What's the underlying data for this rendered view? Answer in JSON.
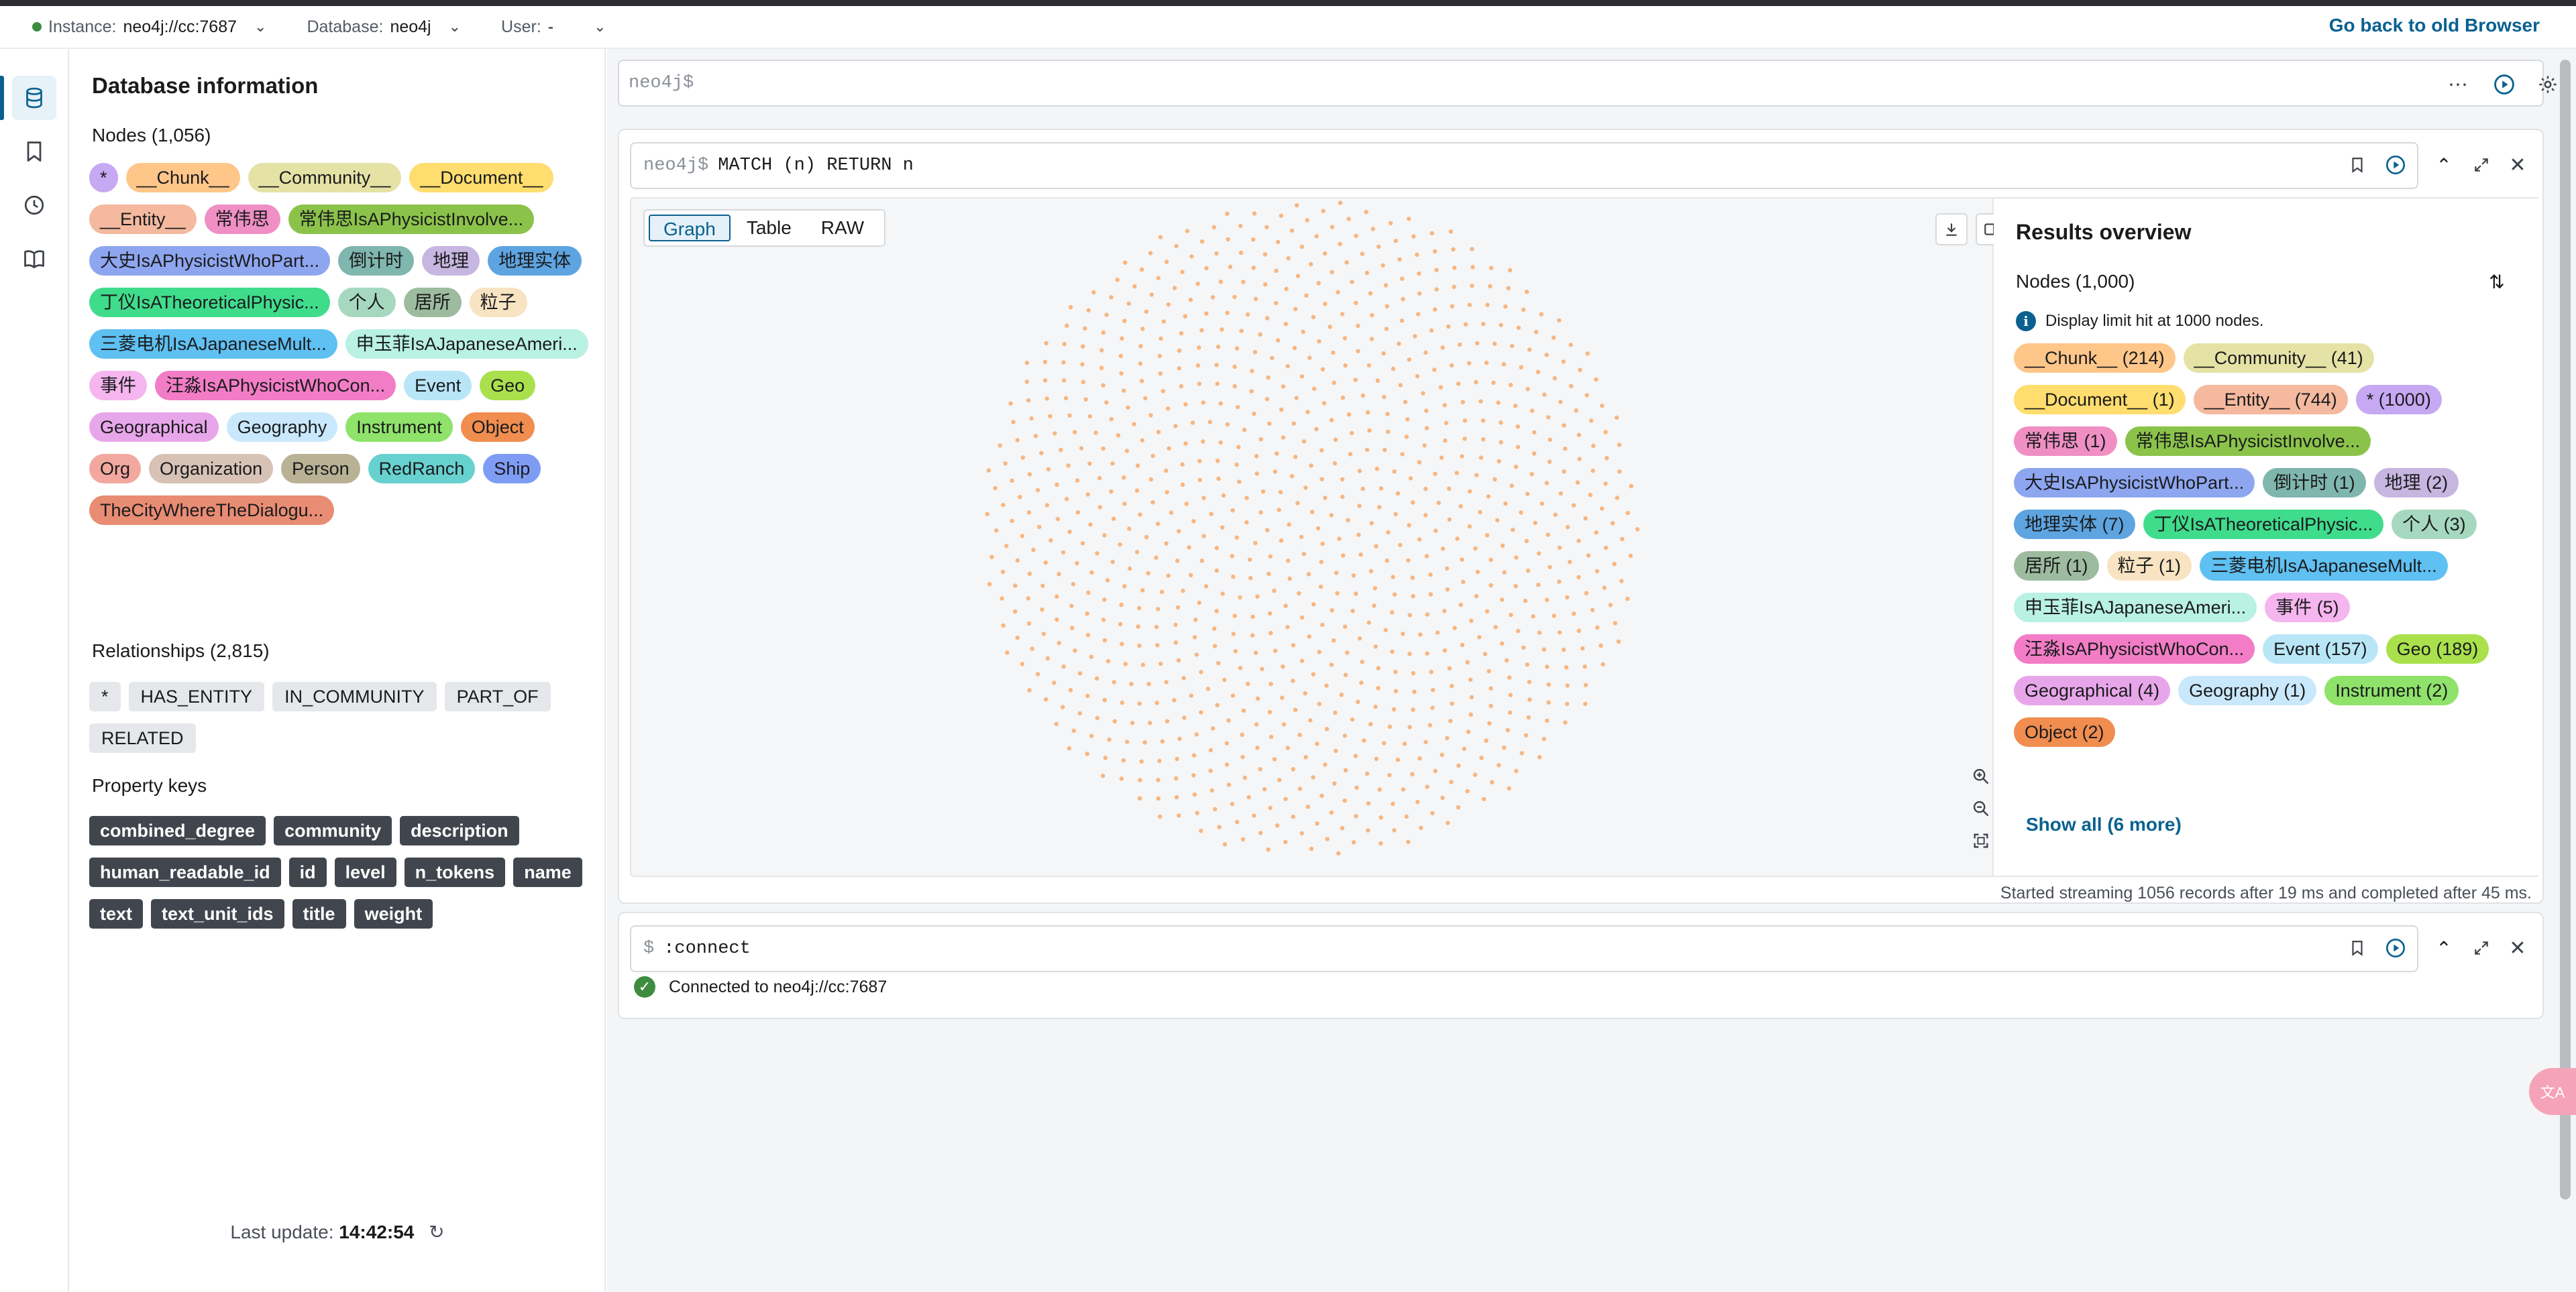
{
  "topbar": {
    "instance_label": "Instance:",
    "instance_value": "neo4j://cc:7687",
    "database_label": "Database:",
    "database_value": "neo4j",
    "user_label": "User:",
    "user_value": "-",
    "go_back": "Go back to old Browser"
  },
  "db_panel": {
    "title": "Database information",
    "nodes_heading": "Nodes (1,056)",
    "node_labels": [
      {
        "label": "*",
        "color": "#c7a8f2"
      },
      {
        "label": "__Chunk__",
        "color": "#ffc68a"
      },
      {
        "label": "__Community__",
        "color": "#e5e2a6"
      },
      {
        "label": "__Document__",
        "color": "#ffdd6e"
      },
      {
        "label": "__Entity__",
        "color": "#f4b99f"
      },
      {
        "label": "常伟思",
        "color": "#ef8fc4"
      },
      {
        "label": "常伟思IsAPhysicistInvolve...",
        "color": "#8bc34a"
      },
      {
        "label": "大史IsAPhysicistWhoPart...",
        "color": "#8ea6ef"
      },
      {
        "label": "倒计时",
        "color": "#7fb6ae"
      },
      {
        "label": "地理",
        "color": "#c7b6e0"
      },
      {
        "label": "地理实体",
        "color": "#5ea4e0"
      },
      {
        "label": "丁仪IsATheoreticalPhysic...",
        "color": "#3fdc8c"
      },
      {
        "label": "个人",
        "color": "#a6d8c0"
      },
      {
        "label": "居所",
        "color": "#9dbb9f"
      },
      {
        "label": "粒子",
        "color": "#f8e3c2"
      },
      {
        "label": "三菱电机IsAJapaneseMult...",
        "color": "#5fc0f2"
      },
      {
        "label": "申玉菲IsAJapaneseAmeri...",
        "color": "#b9f1e2"
      },
      {
        "label": "事件",
        "color": "#f5b5ee"
      },
      {
        "label": "汪淼IsAPhysicistWhoCon...",
        "color": "#f27cc6"
      },
      {
        "label": "Event",
        "color": "#b8e6f7"
      },
      {
        "label": "Geo",
        "color": "#a9e04c"
      },
      {
        "label": "Geographical",
        "color": "#e8a6ea"
      },
      {
        "label": "Geography",
        "color": "#c9e8fb"
      },
      {
        "label": "Instrument",
        "color": "#8fe26a"
      },
      {
        "label": "Object",
        "color": "#f08d4f"
      },
      {
        "label": "Org",
        "color": "#f2a89e"
      },
      {
        "label": "Organization",
        "color": "#d7c2b5"
      },
      {
        "label": "Person",
        "color": "#b8b193"
      },
      {
        "label": "RedRanch",
        "color": "#67d1cf"
      },
      {
        "label": "Ship",
        "color": "#7f9cf5"
      },
      {
        "label": "TheCityWhereTheDialogu...",
        "color": "#e88c73"
      }
    ],
    "relationships_heading": "Relationships (2,815)",
    "relationship_types": [
      "*",
      "HAS_ENTITY",
      "IN_COMMUNITY",
      "PART_OF",
      "RELATED"
    ],
    "property_keys_heading": "Property keys",
    "property_keys": [
      "combined_degree",
      "community",
      "description",
      "human_readable_id",
      "id",
      "level",
      "n_tokens",
      "name",
      "text",
      "text_unit_ids",
      "title",
      "weight"
    ],
    "last_update_label": "Last update:",
    "last_update_time": "14:42:54"
  },
  "editor": {
    "placeholder": "neo4j$"
  },
  "frame1": {
    "prompt": "neo4j$",
    "query": "MATCH (n) RETURN n",
    "tabs": [
      "Graph",
      "Table",
      "RAW"
    ],
    "active_tab": "Graph",
    "graph_node_color": "#f7b681",
    "results_title": "Results overview",
    "results_nodes": "Nodes (1,000)",
    "results_info": "Display limit hit at 1000 nodes.",
    "result_labels": [
      {
        "label": "__Chunk__ (214)",
        "color": "#ffc68a"
      },
      {
        "label": "__Community__ (41)",
        "color": "#e5e2a6"
      },
      {
        "label": "__Document__ (1)",
        "color": "#ffdd6e"
      },
      {
        "label": "__Entity__ (744)",
        "color": "#f4b99f"
      },
      {
        "label": "* (1000)",
        "color": "#c7a8f2"
      },
      {
        "label": "常伟思 (1)",
        "color": "#ef8fc4"
      },
      {
        "label": "常伟思IsAPhysicistInvolve...",
        "color": "#8bc34a"
      },
      {
        "label": "大史IsAPhysicistWhoPart...",
        "color": "#8ea6ef"
      },
      {
        "label": "倒计时 (1)",
        "color": "#7fb6ae"
      },
      {
        "label": "地理 (2)",
        "color": "#c7b6e0"
      },
      {
        "label": "地理实体 (7)",
        "color": "#5ea4e0"
      },
      {
        "label": "丁仪IsATheoreticalPhysic...",
        "color": "#3fdc8c"
      },
      {
        "label": "个人 (3)",
        "color": "#a6d8c0"
      },
      {
        "label": "居所 (1)",
        "color": "#9dbb9f"
      },
      {
        "label": "粒子 (1)",
        "color": "#f8e3c2"
      },
      {
        "label": "三菱电机IsAJapaneseMult...",
        "color": "#5fc0f2"
      },
      {
        "label": "申玉菲IsAJapaneseAmeri...",
        "color": "#b9f1e2"
      },
      {
        "label": "事件 (5)",
        "color": "#f5b5ee"
      },
      {
        "label": "汪淼IsAPhysicistWhoCon...",
        "color": "#f27cc6"
      },
      {
        "label": "Event (157)",
        "color": "#b8e6f7"
      },
      {
        "label": "Geo (189)",
        "color": "#a9e04c"
      },
      {
        "label": "Geographical (4)",
        "color": "#e8a6ea"
      },
      {
        "label": "Geography (1)",
        "color": "#c9e8fb"
      },
      {
        "label": "Instrument (2)",
        "color": "#8fe26a"
      },
      {
        "label": "Object (2)",
        "color": "#f08d4f"
      }
    ],
    "show_all": "Show all (6 more)",
    "status": "Started streaming 1056 records after 19 ms and completed after 45 ms."
  },
  "frame2": {
    "prompt": "$",
    "query": ":connect",
    "connected_text": "Connected to neo4j://cc:7687"
  }
}
